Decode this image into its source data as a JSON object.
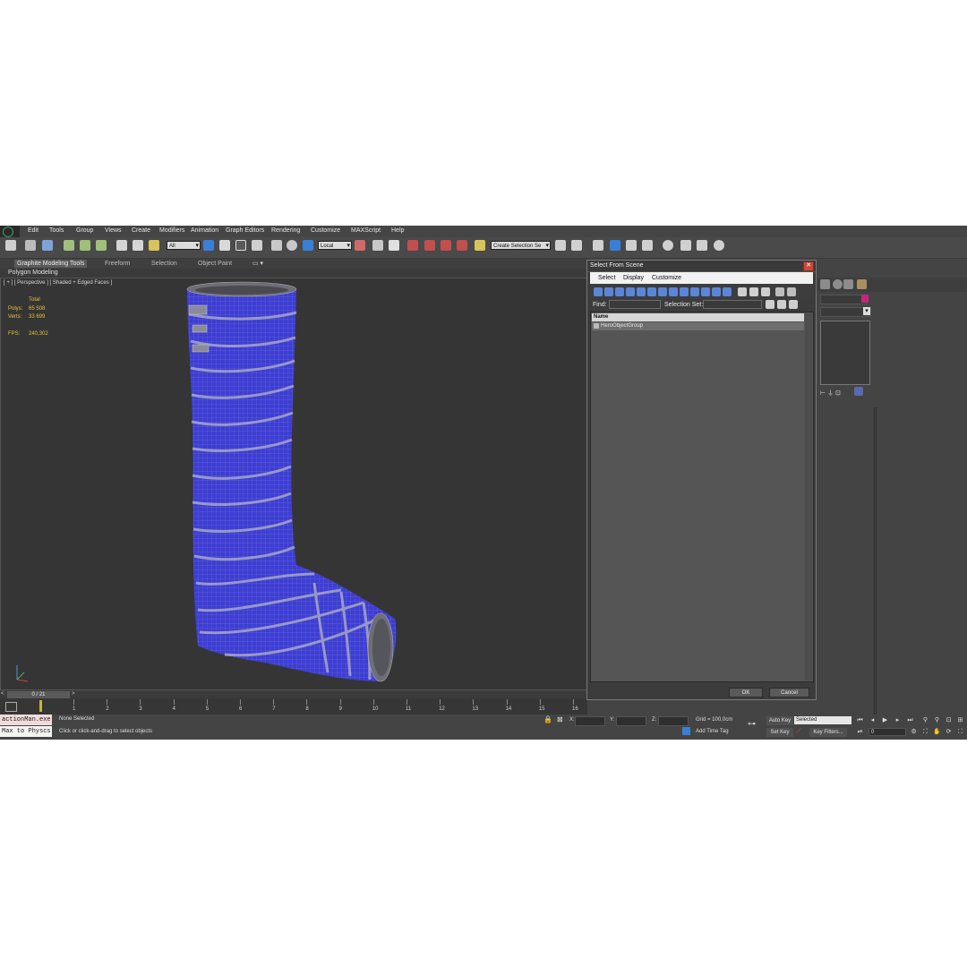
{
  "menu": [
    "Edit",
    "Tools",
    "Group",
    "Views",
    "Create",
    "Modifiers",
    "Animation",
    "Graph Editors",
    "Rendering",
    "Customize",
    "MAXScript",
    "Help"
  ],
  "toolbar": {
    "filter_value": "All",
    "coord_value": "Local",
    "snap_label": "3",
    "named_set_placeholder": "Create Selection Se"
  },
  "ribbon": {
    "tabs": [
      "Graphite Modeling Tools",
      "Freeform",
      "Selection",
      "Object Paint"
    ],
    "subtitle": "Polygon Modeling"
  },
  "viewport": {
    "label": "[ + ] [ Perspective ] [ Shaded + Edged Faces ]",
    "stats": {
      "header": "Total",
      "rows": [
        {
          "key": "Polys:",
          "value": "65 508"
        },
        {
          "key": "Verts:",
          "value": "33 699"
        },
        {
          "key": "FPS:",
          "value": "240,302"
        }
      ]
    },
    "mesh_color": "#3d3dd6",
    "wire_color": "#a9a9b8"
  },
  "timeline": {
    "frame_display": "0 / 21",
    "prev": "<",
    "next": ">",
    "ticks": [
      "1",
      "2",
      "3",
      "4",
      "5",
      "6",
      "7",
      "8",
      "9",
      "10",
      "11",
      "12",
      "13",
      "14",
      "15",
      "16"
    ]
  },
  "status": {
    "maxscript_line1": "actionMan.exe",
    "maxscript_line2": "Max to Physcs",
    "selection": "None Selected",
    "prompt": "Click or click-and-drag to select objects",
    "x_label": "X:",
    "y_label": "Y:",
    "z_label": "Z:",
    "grid": "Grid = 100,0cm",
    "add_time_tag": "Add Time Tag",
    "auto_key": "Auto Key",
    "set_key": "Set Key",
    "key_mode_value": "Selected",
    "key_filters": "Key Filters...",
    "frame_value": "0"
  },
  "dialog": {
    "title": "Select From Scene",
    "menu": [
      "Select",
      "Display",
      "Customize"
    ],
    "find_label": "Find:",
    "selection_set_label": "Selection Set:",
    "column_name": "Name",
    "items": [
      "HeroObjectGroup"
    ],
    "ok": "OK",
    "cancel": "Cancel"
  },
  "command_panel": {
    "accent_color": "#c0287a"
  }
}
